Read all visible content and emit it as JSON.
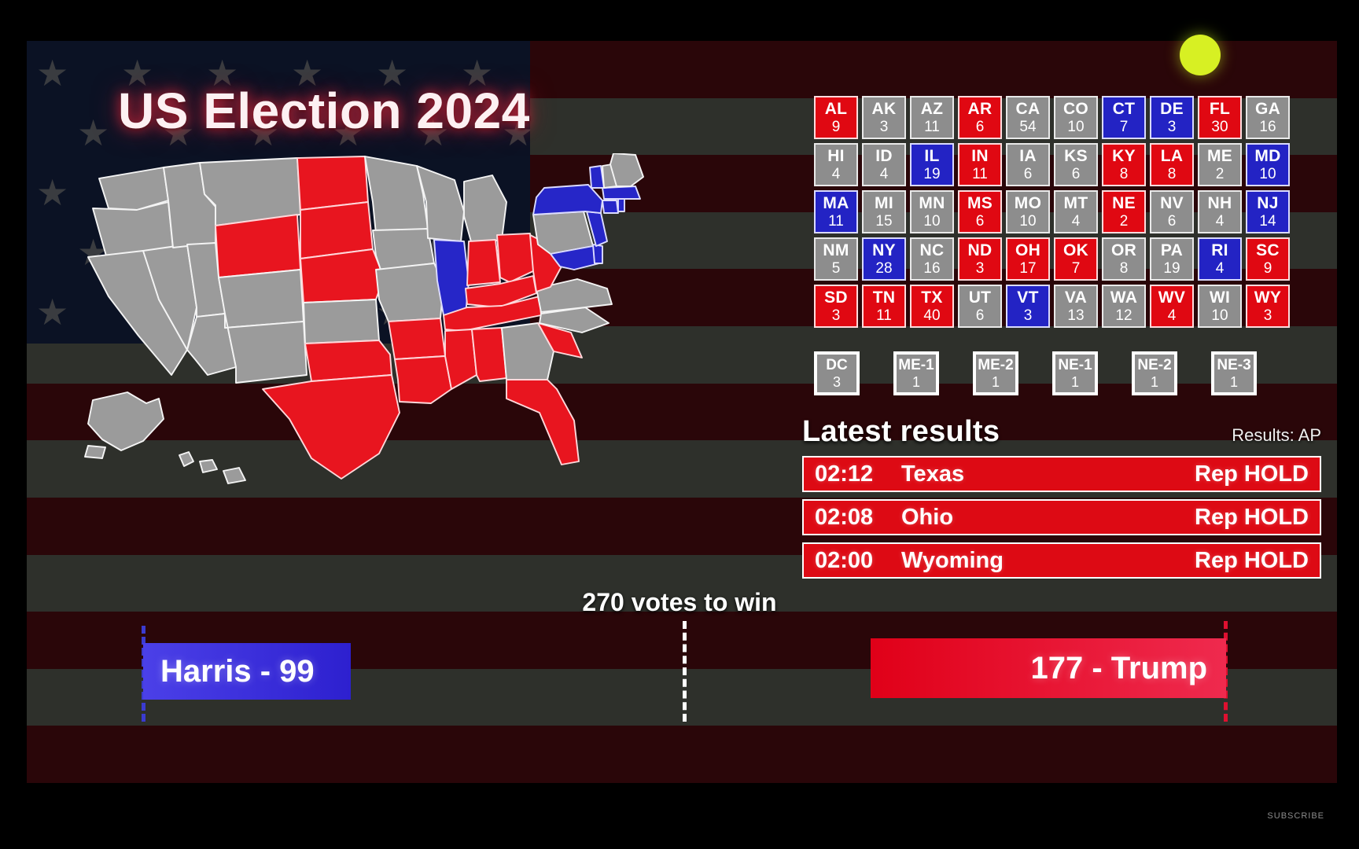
{
  "title": "US Election 2024",
  "live_indicator": "live-dot",
  "subscribe_label": "SUBSCRIBE",
  "colors": {
    "republican": "#e00812",
    "democrat": "#2323c4",
    "uncalled": "#8d8d8d",
    "flag_red": "#2a0609",
    "flag_gray": "#2e302b",
    "canton": "#0b1224",
    "live_dot": "#d7f023"
  },
  "electoral_grid": {
    "rows": [
      [
        {
          "abbr": "AL",
          "votes": "9",
          "party": "red"
        },
        {
          "abbr": "AK",
          "votes": "3",
          "party": "gray"
        },
        {
          "abbr": "AZ",
          "votes": "11",
          "party": "gray"
        },
        {
          "abbr": "AR",
          "votes": "6",
          "party": "red"
        },
        {
          "abbr": "CA",
          "votes": "54",
          "party": "gray"
        },
        {
          "abbr": "CO",
          "votes": "10",
          "party": "gray"
        },
        {
          "abbr": "CT",
          "votes": "7",
          "party": "blue"
        },
        {
          "abbr": "DE",
          "votes": "3",
          "party": "blue"
        },
        {
          "abbr": "FL",
          "votes": "30",
          "party": "red"
        },
        {
          "abbr": "GA",
          "votes": "16",
          "party": "gray"
        }
      ],
      [
        {
          "abbr": "HI",
          "votes": "4",
          "party": "gray"
        },
        {
          "abbr": "ID",
          "votes": "4",
          "party": "gray"
        },
        {
          "abbr": "IL",
          "votes": "19",
          "party": "blue"
        },
        {
          "abbr": "IN",
          "votes": "11",
          "party": "red"
        },
        {
          "abbr": "IA",
          "votes": "6",
          "party": "gray"
        },
        {
          "abbr": "KS",
          "votes": "6",
          "party": "gray"
        },
        {
          "abbr": "KY",
          "votes": "8",
          "party": "red"
        },
        {
          "abbr": "LA",
          "votes": "8",
          "party": "red"
        },
        {
          "abbr": "ME",
          "votes": "2",
          "party": "gray"
        },
        {
          "abbr": "MD",
          "votes": "10",
          "party": "blue"
        }
      ],
      [
        {
          "abbr": "MA",
          "votes": "11",
          "party": "blue"
        },
        {
          "abbr": "MI",
          "votes": "15",
          "party": "gray"
        },
        {
          "abbr": "MN",
          "votes": "10",
          "party": "gray"
        },
        {
          "abbr": "MS",
          "votes": "6",
          "party": "red"
        },
        {
          "abbr": "MO",
          "votes": "10",
          "party": "gray"
        },
        {
          "abbr": "MT",
          "votes": "4",
          "party": "gray"
        },
        {
          "abbr": "NE",
          "votes": "2",
          "party": "red"
        },
        {
          "abbr": "NV",
          "votes": "6",
          "party": "gray"
        },
        {
          "abbr": "NH",
          "votes": "4",
          "party": "gray"
        },
        {
          "abbr": "NJ",
          "votes": "14",
          "party": "blue"
        }
      ],
      [
        {
          "abbr": "NM",
          "votes": "5",
          "party": "gray"
        },
        {
          "abbr": "NY",
          "votes": "28",
          "party": "blue"
        },
        {
          "abbr": "NC",
          "votes": "16",
          "party": "gray"
        },
        {
          "abbr": "ND",
          "votes": "3",
          "party": "red"
        },
        {
          "abbr": "OH",
          "votes": "17",
          "party": "red"
        },
        {
          "abbr": "OK",
          "votes": "7",
          "party": "red"
        },
        {
          "abbr": "OR",
          "votes": "8",
          "party": "gray"
        },
        {
          "abbr": "PA",
          "votes": "19",
          "party": "gray"
        },
        {
          "abbr": "RI",
          "votes": "4",
          "party": "blue"
        },
        {
          "abbr": "SC",
          "votes": "9",
          "party": "red"
        }
      ],
      [
        {
          "abbr": "SD",
          "votes": "3",
          "party": "red"
        },
        {
          "abbr": "TN",
          "votes": "11",
          "party": "red"
        },
        {
          "abbr": "TX",
          "votes": "40",
          "party": "red"
        },
        {
          "abbr": "UT",
          "votes": "6",
          "party": "gray"
        },
        {
          "abbr": "VT",
          "votes": "3",
          "party": "blue"
        },
        {
          "abbr": "VA",
          "votes": "13",
          "party": "gray"
        },
        {
          "abbr": "WA",
          "votes": "12",
          "party": "gray"
        },
        {
          "abbr": "WV",
          "votes": "4",
          "party": "red"
        },
        {
          "abbr": "WI",
          "votes": "10",
          "party": "gray"
        },
        {
          "abbr": "WY",
          "votes": "3",
          "party": "red"
        }
      ]
    ],
    "districts": [
      {
        "abbr": "DC",
        "votes": "3",
        "party": "gray"
      },
      {
        "abbr": "ME-1",
        "votes": "1",
        "party": "gray"
      },
      {
        "abbr": "ME-2",
        "votes": "1",
        "party": "gray"
      },
      {
        "abbr": "NE-1",
        "votes": "1",
        "party": "gray"
      },
      {
        "abbr": "NE-2",
        "votes": "1",
        "party": "gray"
      },
      {
        "abbr": "NE-3",
        "votes": "1",
        "party": "gray"
      }
    ]
  },
  "latest_results": {
    "title": "Latest results",
    "source": "Results: AP",
    "rows": [
      {
        "time": "02:12",
        "state": "Texas",
        "status": "Rep HOLD",
        "party": "red"
      },
      {
        "time": "02:08",
        "state": "Ohio",
        "status": "Rep HOLD",
        "party": "red"
      },
      {
        "time": "02:00",
        "state": "Wyoming",
        "status": "Rep HOLD",
        "party": "red"
      }
    ]
  },
  "tally": {
    "votes_to_win": "270 votes to win",
    "harris_label": "Harris - 99",
    "trump_label": "177 - Trump",
    "harris_votes": 99,
    "trump_votes": 177,
    "threshold": 270
  },
  "map": {
    "called_red": [
      "AL",
      "AR",
      "FL",
      "IN",
      "KY",
      "LA",
      "MS",
      "NE",
      "ND",
      "OH",
      "OK",
      "SC",
      "SD",
      "TN",
      "TX",
      "WV",
      "WY"
    ],
    "called_blue": [
      "CT",
      "DE",
      "IL",
      "MD",
      "MA",
      "NJ",
      "NY",
      "RI",
      "VT"
    ],
    "uncalled": [
      "AK",
      "AZ",
      "CA",
      "CO",
      "GA",
      "HI",
      "ID",
      "IA",
      "KS",
      "ME",
      "MI",
      "MN",
      "MO",
      "MT",
      "NV",
      "NH",
      "NM",
      "NC",
      "OR",
      "PA",
      "UT",
      "VA",
      "WA",
      "WI"
    ]
  }
}
